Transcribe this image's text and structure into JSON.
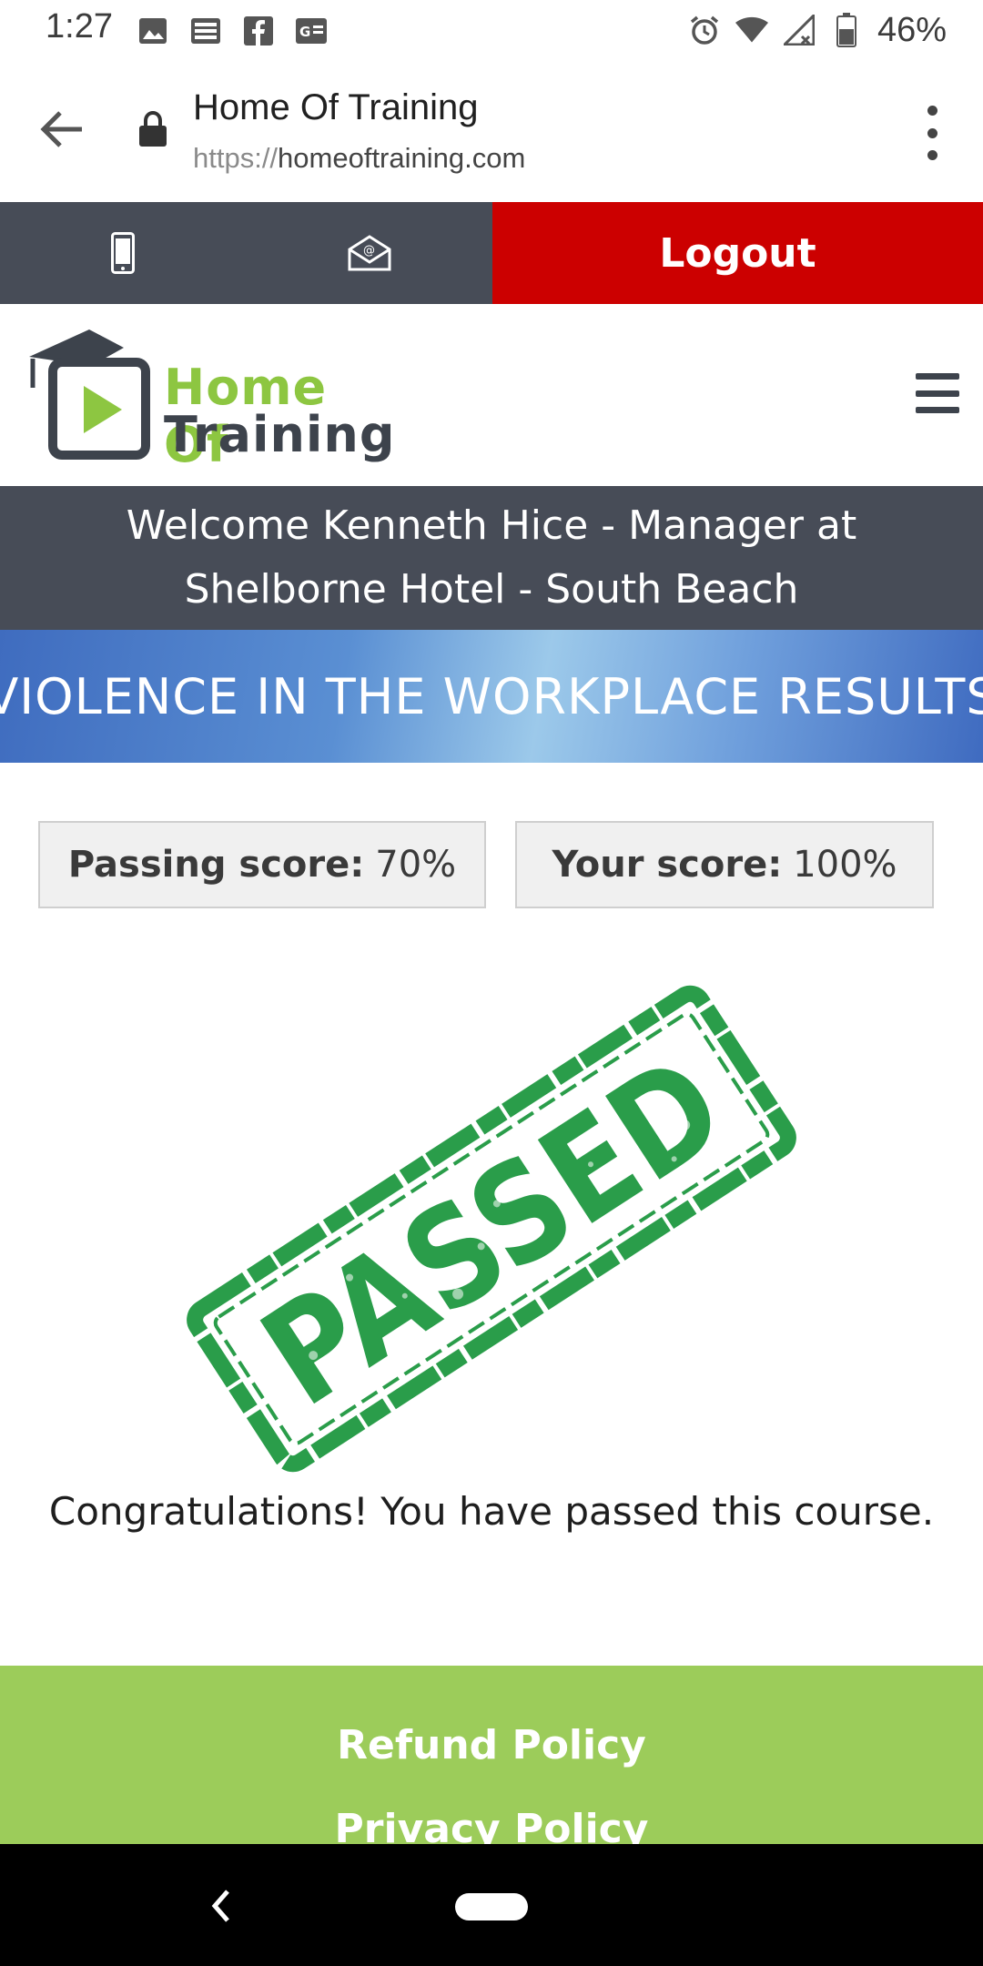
{
  "status_bar": {
    "time": "1:27",
    "battery": "46%",
    "left_icons": [
      "image-icon",
      "news-icon",
      "facebook-icon",
      "google-news-icon"
    ],
    "right_icons": [
      "alarm-icon",
      "wifi-icon",
      "signal-icon",
      "battery-icon"
    ]
  },
  "browser": {
    "page_title": "Home Of Training",
    "url_scheme": "https://",
    "url_host": "homeoftraining.com"
  },
  "contact_strip": {
    "logout_label": "Logout",
    "colors": {
      "strip": "#474c57",
      "logout": "#cc0000"
    }
  },
  "header": {
    "logo_line1": "Home Of",
    "logo_line2": "Training",
    "colors": {
      "green": "#8dc641",
      "dark": "#3d434c"
    }
  },
  "welcome": {
    "text": "Welcome Kenneth Hice - Manager at Shelborne Hotel - South Beach"
  },
  "course": {
    "title": "VIOLENCE IN THE WORKPLACE RESULTS"
  },
  "scores": {
    "passing_label": "Passing score:",
    "passing_value": "70%",
    "your_label": "Your score:",
    "your_value": "100%"
  },
  "result": {
    "stamp_text": "PASSED",
    "stamp_color": "#2a9d4a",
    "message": "Congratulations! You have passed this course."
  },
  "footer": {
    "links": [
      "Refund Policy",
      "Privacy Policy"
    ],
    "color": "#9ccc5a"
  }
}
